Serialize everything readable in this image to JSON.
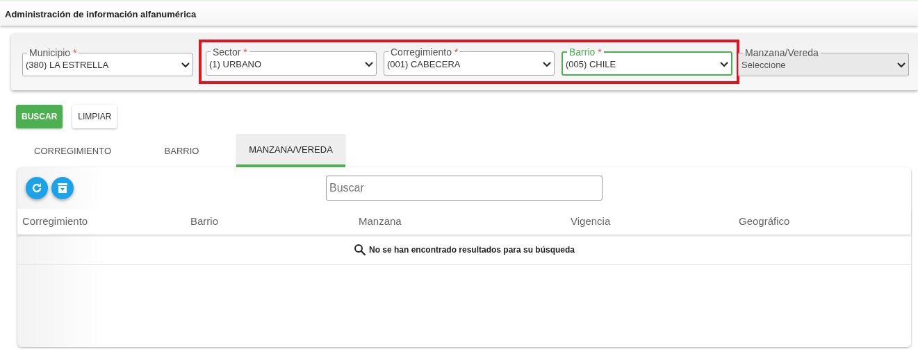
{
  "page_title": "Administración de información alfanumérica",
  "filters": [
    {
      "label": "Municipio",
      "required_mark": "*",
      "value": "(380) LA ESTRELLA",
      "focused": false,
      "disabled": false,
      "highlighted": false
    },
    {
      "label": "Sector",
      "required_mark": "*",
      "value": "(1) URBANO",
      "focused": false,
      "disabled": false,
      "highlighted": true
    },
    {
      "label": "Corregimiento",
      "required_mark": "*",
      "value": "(001) CABECERA",
      "focused": false,
      "disabled": false,
      "highlighted": true
    },
    {
      "label": "Barrio",
      "required_mark": "*",
      "value": "(005) CHILE",
      "focused": true,
      "disabled": false,
      "highlighted": true
    },
    {
      "label": "Manzana/Vereda",
      "value": "Seleccione",
      "focused": false,
      "disabled": true,
      "highlighted": false
    }
  ],
  "buttons": [
    {
      "label": "BUSCAR",
      "kind": "primary"
    },
    {
      "label": "LIMPIAR",
      "kind": "secondary"
    }
  ],
  "tabs": [
    {
      "label": "CORREGIMIENTO",
      "selected": false
    },
    {
      "label": "BARRIO",
      "selected": false
    },
    {
      "label": "MANZANA/VEREDA",
      "selected": true
    }
  ],
  "table": {
    "search": {
      "placeholder": "Buscar"
    },
    "columns": [
      "Corregimiento",
      "Barrio",
      "Manzana",
      "Vigencia",
      "Geográfico"
    ],
    "empty_message": "No se han encontrado resultados para su búsqueda"
  }
}
